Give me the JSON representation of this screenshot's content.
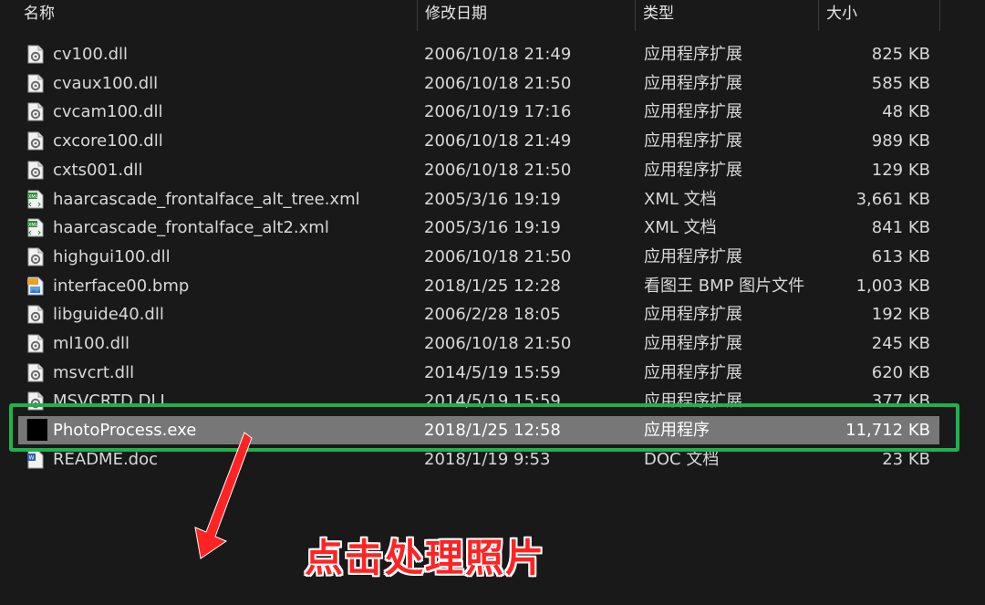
{
  "columns": {
    "name": "名称",
    "modified": "修改日期",
    "type": "类型",
    "size": "大小"
  },
  "files": [
    {
      "name": "cv100.dll",
      "modified": "2006/10/18 21:49",
      "type": "应用程序扩展",
      "size": "825 KB",
      "icon": "dll-gear-icon"
    },
    {
      "name": "cvaux100.dll",
      "modified": "2006/10/18 21:50",
      "type": "应用程序扩展",
      "size": "585 KB",
      "icon": "dll-gear-icon"
    },
    {
      "name": "cvcam100.dll",
      "modified": "2006/10/19 17:16",
      "type": "应用程序扩展",
      "size": "48 KB",
      "icon": "dll-gear-icon"
    },
    {
      "name": "cxcore100.dll",
      "modified": "2006/10/18 21:49",
      "type": "应用程序扩展",
      "size": "989 KB",
      "icon": "dll-gear-icon"
    },
    {
      "name": "cxts001.dll",
      "modified": "2006/10/18 21:50",
      "type": "应用程序扩展",
      "size": "129 KB",
      "icon": "dll-gear-icon"
    },
    {
      "name": "haarcascade_frontalface_alt_tree.xml",
      "modified": "2005/3/16 19:19",
      "type": "XML 文档",
      "size": "3,661 KB",
      "icon": "xml-file-icon"
    },
    {
      "name": "haarcascade_frontalface_alt2.xml",
      "modified": "2005/3/16 19:19",
      "type": "XML 文档",
      "size": "841 KB",
      "icon": "xml-file-icon"
    },
    {
      "name": "highgui100.dll",
      "modified": "2006/10/18 21:50",
      "type": "应用程序扩展",
      "size": "613 KB",
      "icon": "dll-gear-icon"
    },
    {
      "name": "interface00.bmp",
      "modified": "2018/1/25 12:28",
      "type": "看图王 BMP 图片文件",
      "size": "1,003 KB",
      "icon": "bmp-image-icon"
    },
    {
      "name": "libguide40.dll",
      "modified": "2006/2/28 18:05",
      "type": "应用程序扩展",
      "size": "192 KB",
      "icon": "dll-gear-icon"
    },
    {
      "name": "ml100.dll",
      "modified": "2006/10/18 21:50",
      "type": "应用程序扩展",
      "size": "245 KB",
      "icon": "dll-gear-icon"
    },
    {
      "name": "msvcrt.dll",
      "modified": "2014/5/19 15:59",
      "type": "应用程序扩展",
      "size": "620 KB",
      "icon": "dll-gear-icon"
    },
    {
      "name": "MSVCRTD.DLL",
      "modified": "2014/5/19 15:59",
      "type": "应用程序扩展",
      "size": "377 KB",
      "icon": "dll-gear-icon"
    },
    {
      "name": "PhotoProcess.exe",
      "modified": "2018/1/25 12:58",
      "type": "应用程序",
      "size": "11,712 KB",
      "icon": "exe-app-icon",
      "selected": true
    },
    {
      "name": "README.doc",
      "modified": "2018/1/19 9:53",
      "type": "DOC 文档",
      "size": "23 KB",
      "icon": "doc-file-icon"
    }
  ],
  "annotation": {
    "callout_text": "点击处理照片",
    "highlight_color": "#1db34a",
    "arrow_color": "#ff2323"
  }
}
